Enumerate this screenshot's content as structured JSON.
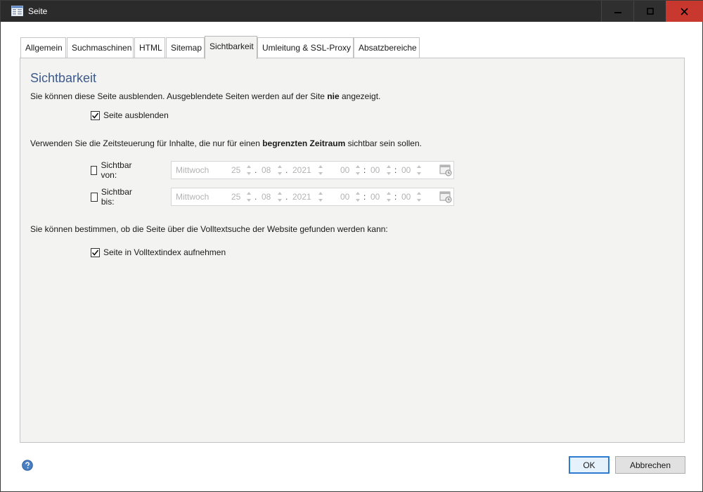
{
  "window": {
    "title": "Seite",
    "controls": {
      "minimize": "—",
      "maximize": "☐",
      "close": "✕"
    }
  },
  "tabs": [
    {
      "label": "Allgemein",
      "active": false
    },
    {
      "label": "Suchmaschinen",
      "active": false
    },
    {
      "label": "HTML",
      "active": false
    },
    {
      "label": "Sitemap",
      "active": false
    },
    {
      "label": "Sichtbarkeit",
      "active": true
    },
    {
      "label": "Umleitung & SSL-Proxy",
      "active": false
    },
    {
      "label": "Absatzbereiche",
      "active": false
    }
  ],
  "panel": {
    "heading": "Sichtbarkeit",
    "hide_text_pre": "Sie können diese Seite ausblenden. Ausgeblendete Seiten werden auf der Site ",
    "hide_text_bold": "nie",
    "hide_text_post": " angezeigt.",
    "hide_checkbox": {
      "label": "Seite ausblenden",
      "checked": true
    },
    "timing_text_pre": "Verwenden Sie die Zeitsteuerung für Inhalte, die nur für einen ",
    "timing_text_bold": "begrenzten Zeitraum",
    "timing_text_post": " sichtbar sein sollen.",
    "visible_from": {
      "label": "Sichtbar von:",
      "checked": false,
      "weekday": "Mittwoch",
      "day": "25",
      "month": "08",
      "year": "2021",
      "hour": "00",
      "minute": "00",
      "second": "00"
    },
    "visible_until": {
      "label": "Sichtbar bis:",
      "checked": false,
      "weekday": "Mittwoch",
      "day": "25",
      "month": "08",
      "year": "2021",
      "hour": "00",
      "minute": "00",
      "second": "00"
    },
    "search_text": "Sie können bestimmen, ob die Seite über die Volltextsuche der Website gefunden werden kann:",
    "index_checkbox": {
      "label": "Seite in Volltextindex aufnehmen",
      "checked": true
    }
  },
  "footer": {
    "help_icon": "help-icon",
    "ok_label": "OK",
    "cancel_label": "Abbrechen"
  },
  "colors": {
    "titlebar": "#2b2b2b",
    "close_button": "#c9382f",
    "heading": "#3d5a8a",
    "panel_bg": "#f3f3f2"
  }
}
